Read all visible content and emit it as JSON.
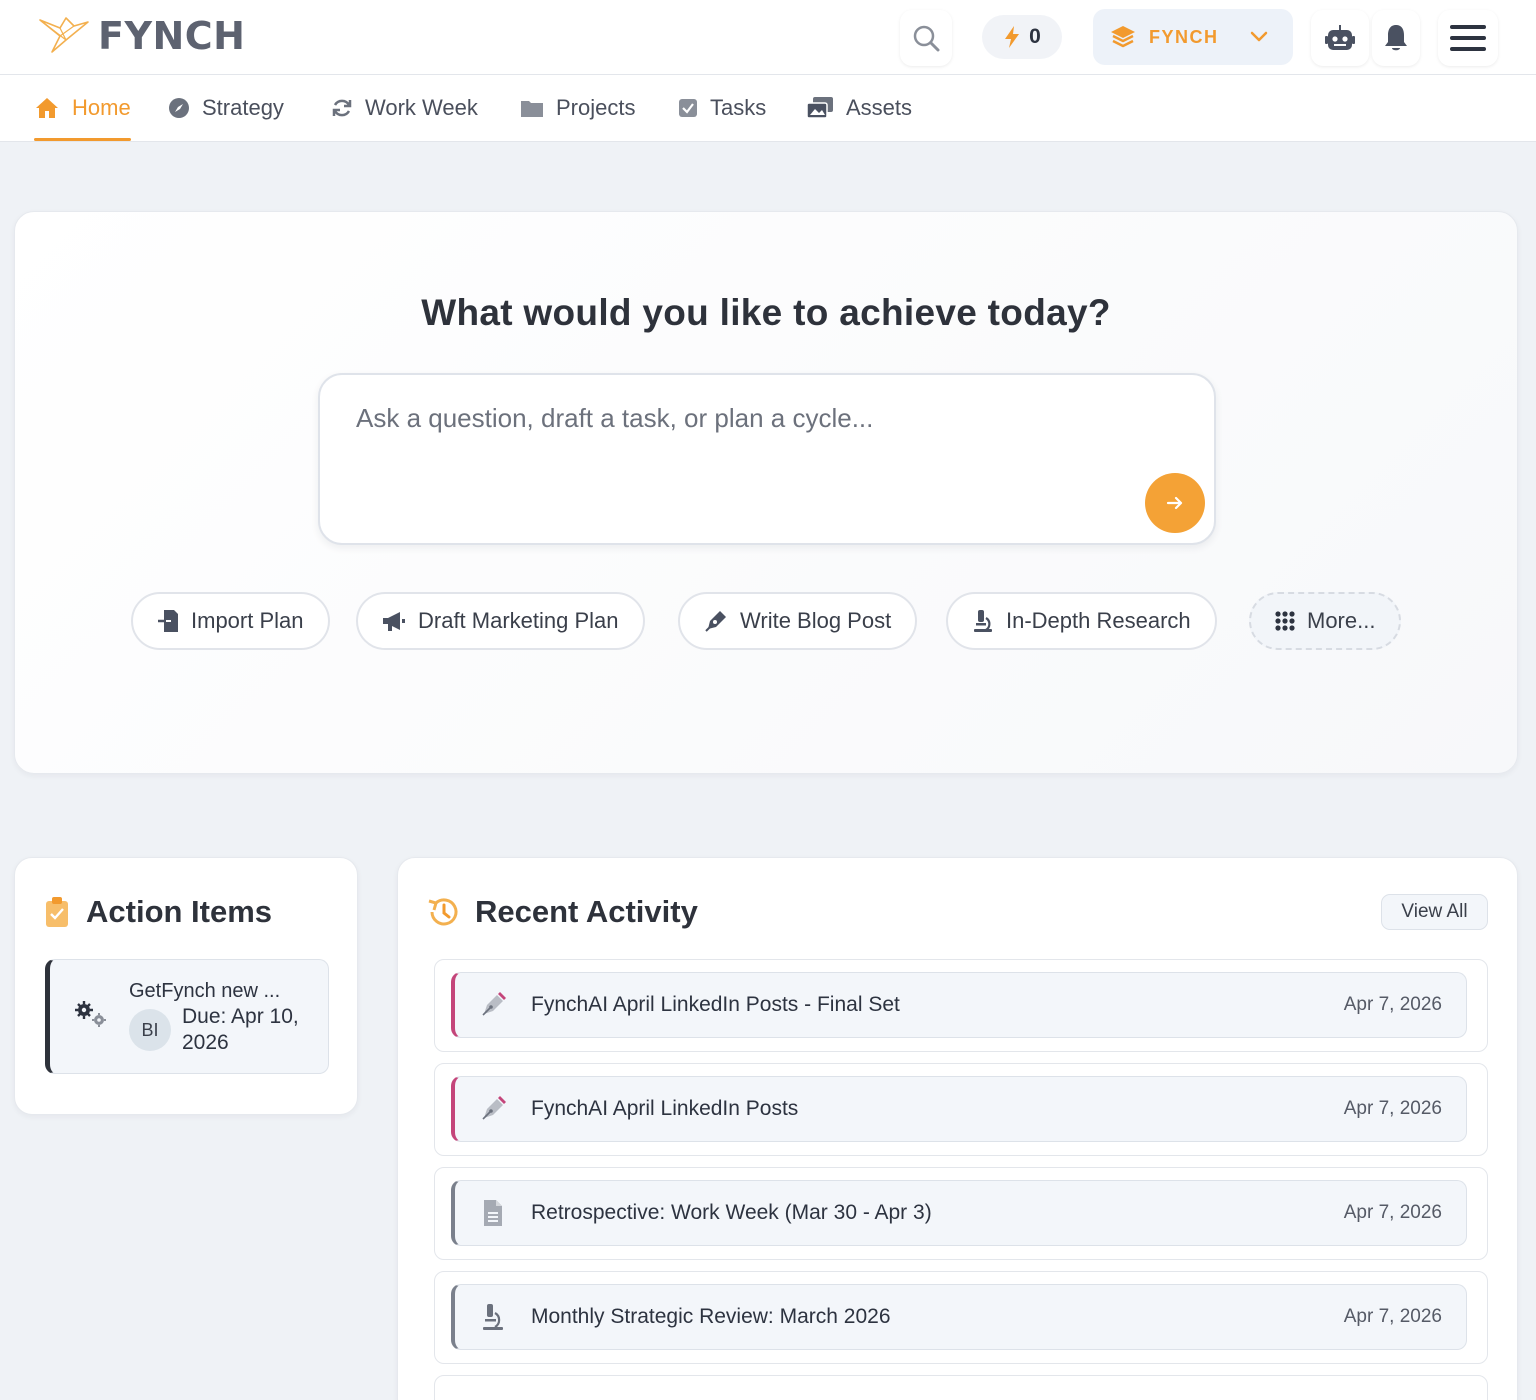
{
  "header": {
    "brand": "FYNCH",
    "credits": "0",
    "workspace": "FYNCH"
  },
  "nav": {
    "items": [
      {
        "label": "Home",
        "icon": "home-icon",
        "active": true
      },
      {
        "label": "Strategy",
        "icon": "compass-icon"
      },
      {
        "label": "Work Week",
        "icon": "refresh-icon"
      },
      {
        "label": "Projects",
        "icon": "folder-icon"
      },
      {
        "label": "Tasks",
        "icon": "checkbox-icon"
      },
      {
        "label": "Assets",
        "icon": "images-icon"
      }
    ]
  },
  "hero": {
    "title": "What would you like to achieve today?",
    "placeholder": "Ask a question, draft a task, or plan a cycle...",
    "chips": [
      {
        "label": "Import Plan",
        "icon": "import-icon"
      },
      {
        "label": "Draft Marketing Plan",
        "icon": "megaphone-icon"
      },
      {
        "label": "Write Blog Post",
        "icon": "pen-icon"
      },
      {
        "label": "In-Depth Research",
        "icon": "microscope-icon"
      },
      {
        "label": "More...",
        "icon": "grid-icon"
      }
    ]
  },
  "action_items": {
    "title": "Action Items",
    "items": [
      {
        "name": "GetFynch new ...",
        "avatar": "BI",
        "due": "Due: Apr 10, 2026"
      }
    ]
  },
  "recent_activity": {
    "title": "Recent Activity",
    "view_all": "View All",
    "items": [
      {
        "title": "FynchAI April LinkedIn Posts - Final Set",
        "date": "Apr 7, 2026",
        "icon": "pen-nib-icon",
        "accent": "#c4457a"
      },
      {
        "title": "FynchAI April LinkedIn Posts",
        "date": "Apr 7, 2026",
        "icon": "pen-nib-icon",
        "accent": "#c4457a"
      },
      {
        "title": "Retrospective: Work Week (Mar 30 - Apr 3)",
        "date": "Apr 7, 2026",
        "icon": "document-icon",
        "accent": "#7a808c"
      },
      {
        "title": "Monthly Strategic Review: March 2026",
        "date": "Apr 7, 2026",
        "icon": "microscope-icon",
        "accent": "#7a808c"
      }
    ]
  },
  "colors": {
    "accent": "#f29a2e",
    "background": "#eff2f6"
  }
}
